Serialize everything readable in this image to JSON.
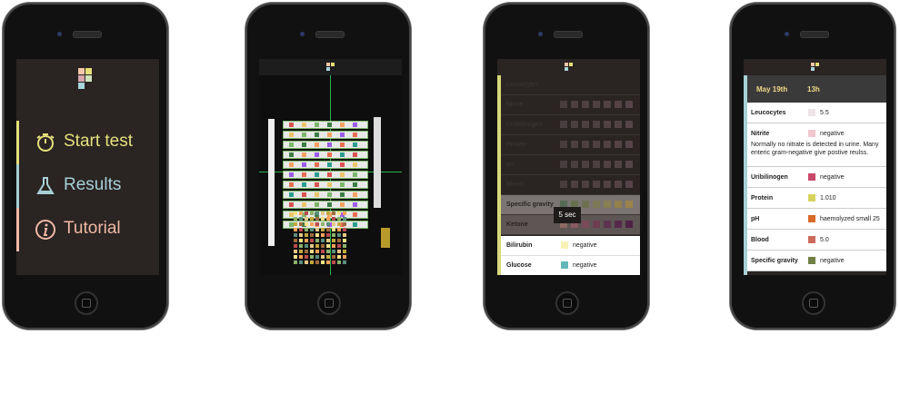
{
  "menu": {
    "items": [
      {
        "label": "Start test",
        "color": "#e4e07c"
      },
      {
        "label": "Results",
        "color": "#a7d0d6"
      },
      {
        "label": "Tutorial",
        "color": "#f0b9a6"
      }
    ]
  },
  "test": {
    "timer": "5 sec",
    "dim_rows": [
      "Leucocytes",
      "Nitrite",
      "Urobilinogen",
      "Protein",
      "pH",
      "Blood"
    ],
    "specific_gravity": "Specific gravity",
    "ketone": "Ketone",
    "rows": [
      {
        "name": "Bilirubin",
        "value": "negative",
        "color": "#f7f3b4"
      },
      {
        "name": "Glucose",
        "value": "negative",
        "color": "#63b7b9"
      }
    ]
  },
  "results": {
    "date": "May 19th",
    "time": "13h",
    "rows": [
      {
        "name": "Leucocytes",
        "value": "5.5",
        "color": "#eee3e6"
      },
      {
        "name": "Nitrite",
        "value": "negative",
        "color": "#f2c6cf",
        "note": "Normally no nitrate is detected in urine. Many enteric gram-negative give postive reulss."
      },
      {
        "name": "Uribilinogen",
        "value": "negative",
        "color": "#c9486b"
      },
      {
        "name": "Protein",
        "value": "1.010",
        "color": "#d7d25e"
      },
      {
        "name": "pH",
        "value": "haemolyzed small 25",
        "color": "#d96a2a"
      },
      {
        "name": "Blood",
        "value": "5.0",
        "color": "#cc6b5c"
      },
      {
        "name": "Specific gravity",
        "value": "negative",
        "color": "#6f7f45"
      }
    ]
  }
}
